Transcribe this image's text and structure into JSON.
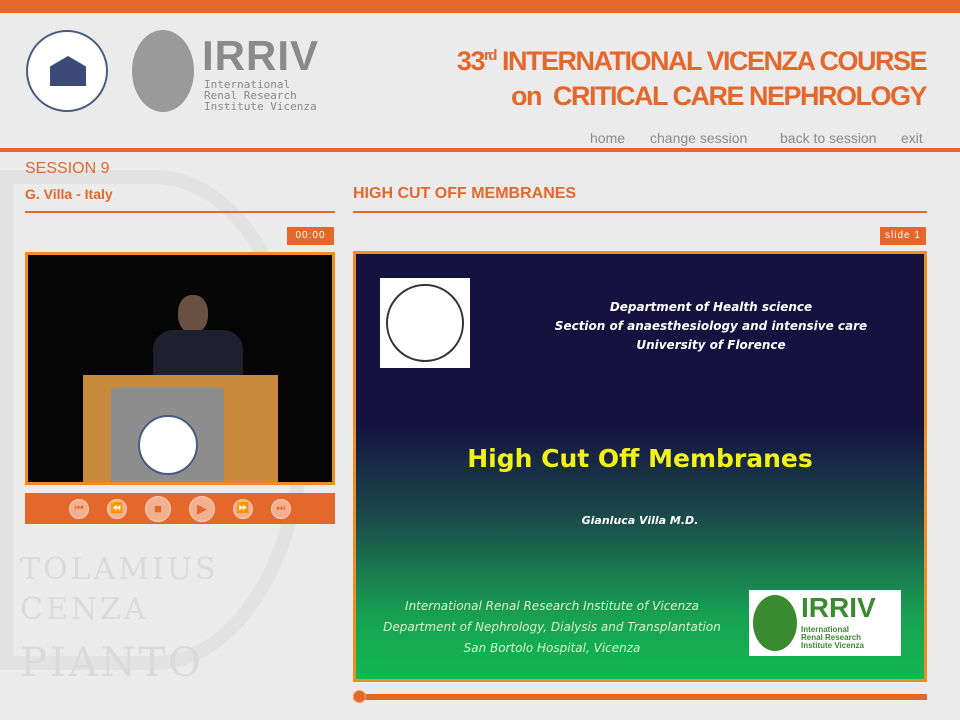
{
  "header": {
    "title_num": "33",
    "title_sup": "rd",
    "title_line1": "INTERNATIONAL VICENZA COURSE",
    "title_line2_on": "on",
    "title_line2": "CRITICAL CARE NEPHROLOGY",
    "irriv_logo": "IRRIV",
    "irriv_sub": [
      "International",
      "Renal Research",
      "Institute Vicenza"
    ]
  },
  "nav": {
    "home": "home",
    "change_session": "change session",
    "back_to_session": "back to session",
    "exit": "exit"
  },
  "session": {
    "label": "SESSION 9",
    "speaker": "G. Villa - Italy",
    "talk_title": "HIGH CUT OFF MEMBRANES"
  },
  "player": {
    "time": "00:00",
    "slide_label": "slide 1",
    "progress": 0
  },
  "watermark": [
    "TOLAMIUS",
    "CENZA",
    "PIANTO"
  ],
  "slide": {
    "dept": [
      "Department of Health science",
      "Section of anaesthesiology and intensive care",
      "University of Florence"
    ],
    "title": "High Cut Off Membranes",
    "author": "Gianluca Villa M.D.",
    "institute": [
      "International Renal Research Institute of Vicenza",
      "Department of Nephrology, Dialysis and Transplantation",
      "San Bortolo Hospital, Vicenza"
    ],
    "logo": "IRRIV",
    "logo_sub": [
      "International",
      "Renal Research",
      "Institute Vicenza"
    ]
  }
}
